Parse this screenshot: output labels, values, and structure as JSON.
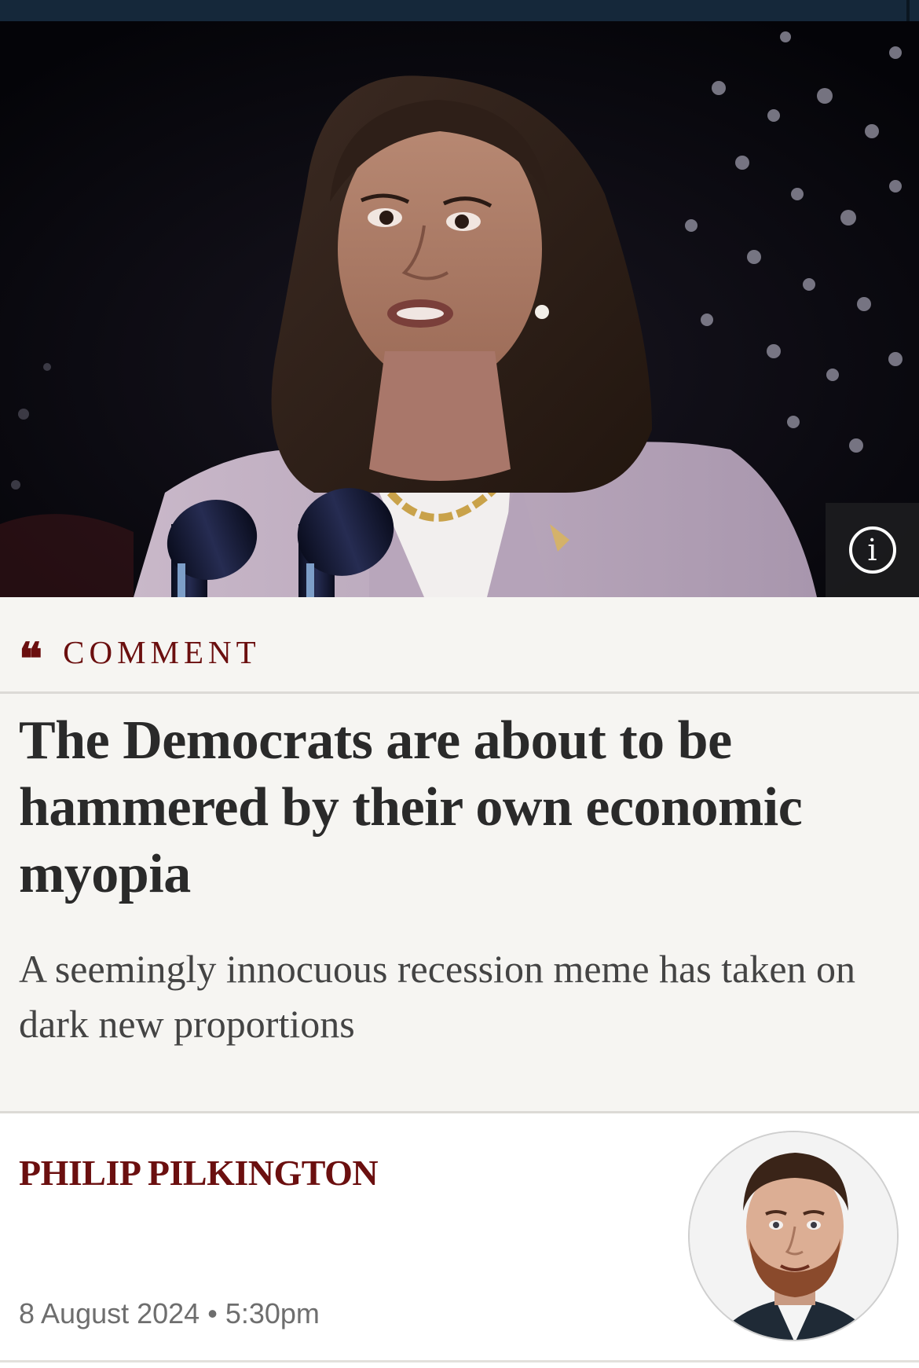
{
  "hero": {
    "image_alt": "Woman speaking at a podium with microphones in front of a starry flag backdrop",
    "info_icon": "info-icon"
  },
  "article": {
    "section_icon": "quote-mark-icon",
    "section_label": "COMMENT",
    "headline": "The Democrats are about to be hammered by their own economic myopia",
    "standfirst": "A seemingly innocuous recession meme has taken on dark new proportions"
  },
  "byline": {
    "author": "PHILIP PILKINGTON",
    "date": "8 August 2024",
    "separator": "•",
    "time": "5:30pm",
    "avatar_alt": "Author headshot"
  },
  "colors": {
    "accent": "#6b0f0f",
    "background": "#f6f5f2",
    "top_bar": "#15283a"
  }
}
